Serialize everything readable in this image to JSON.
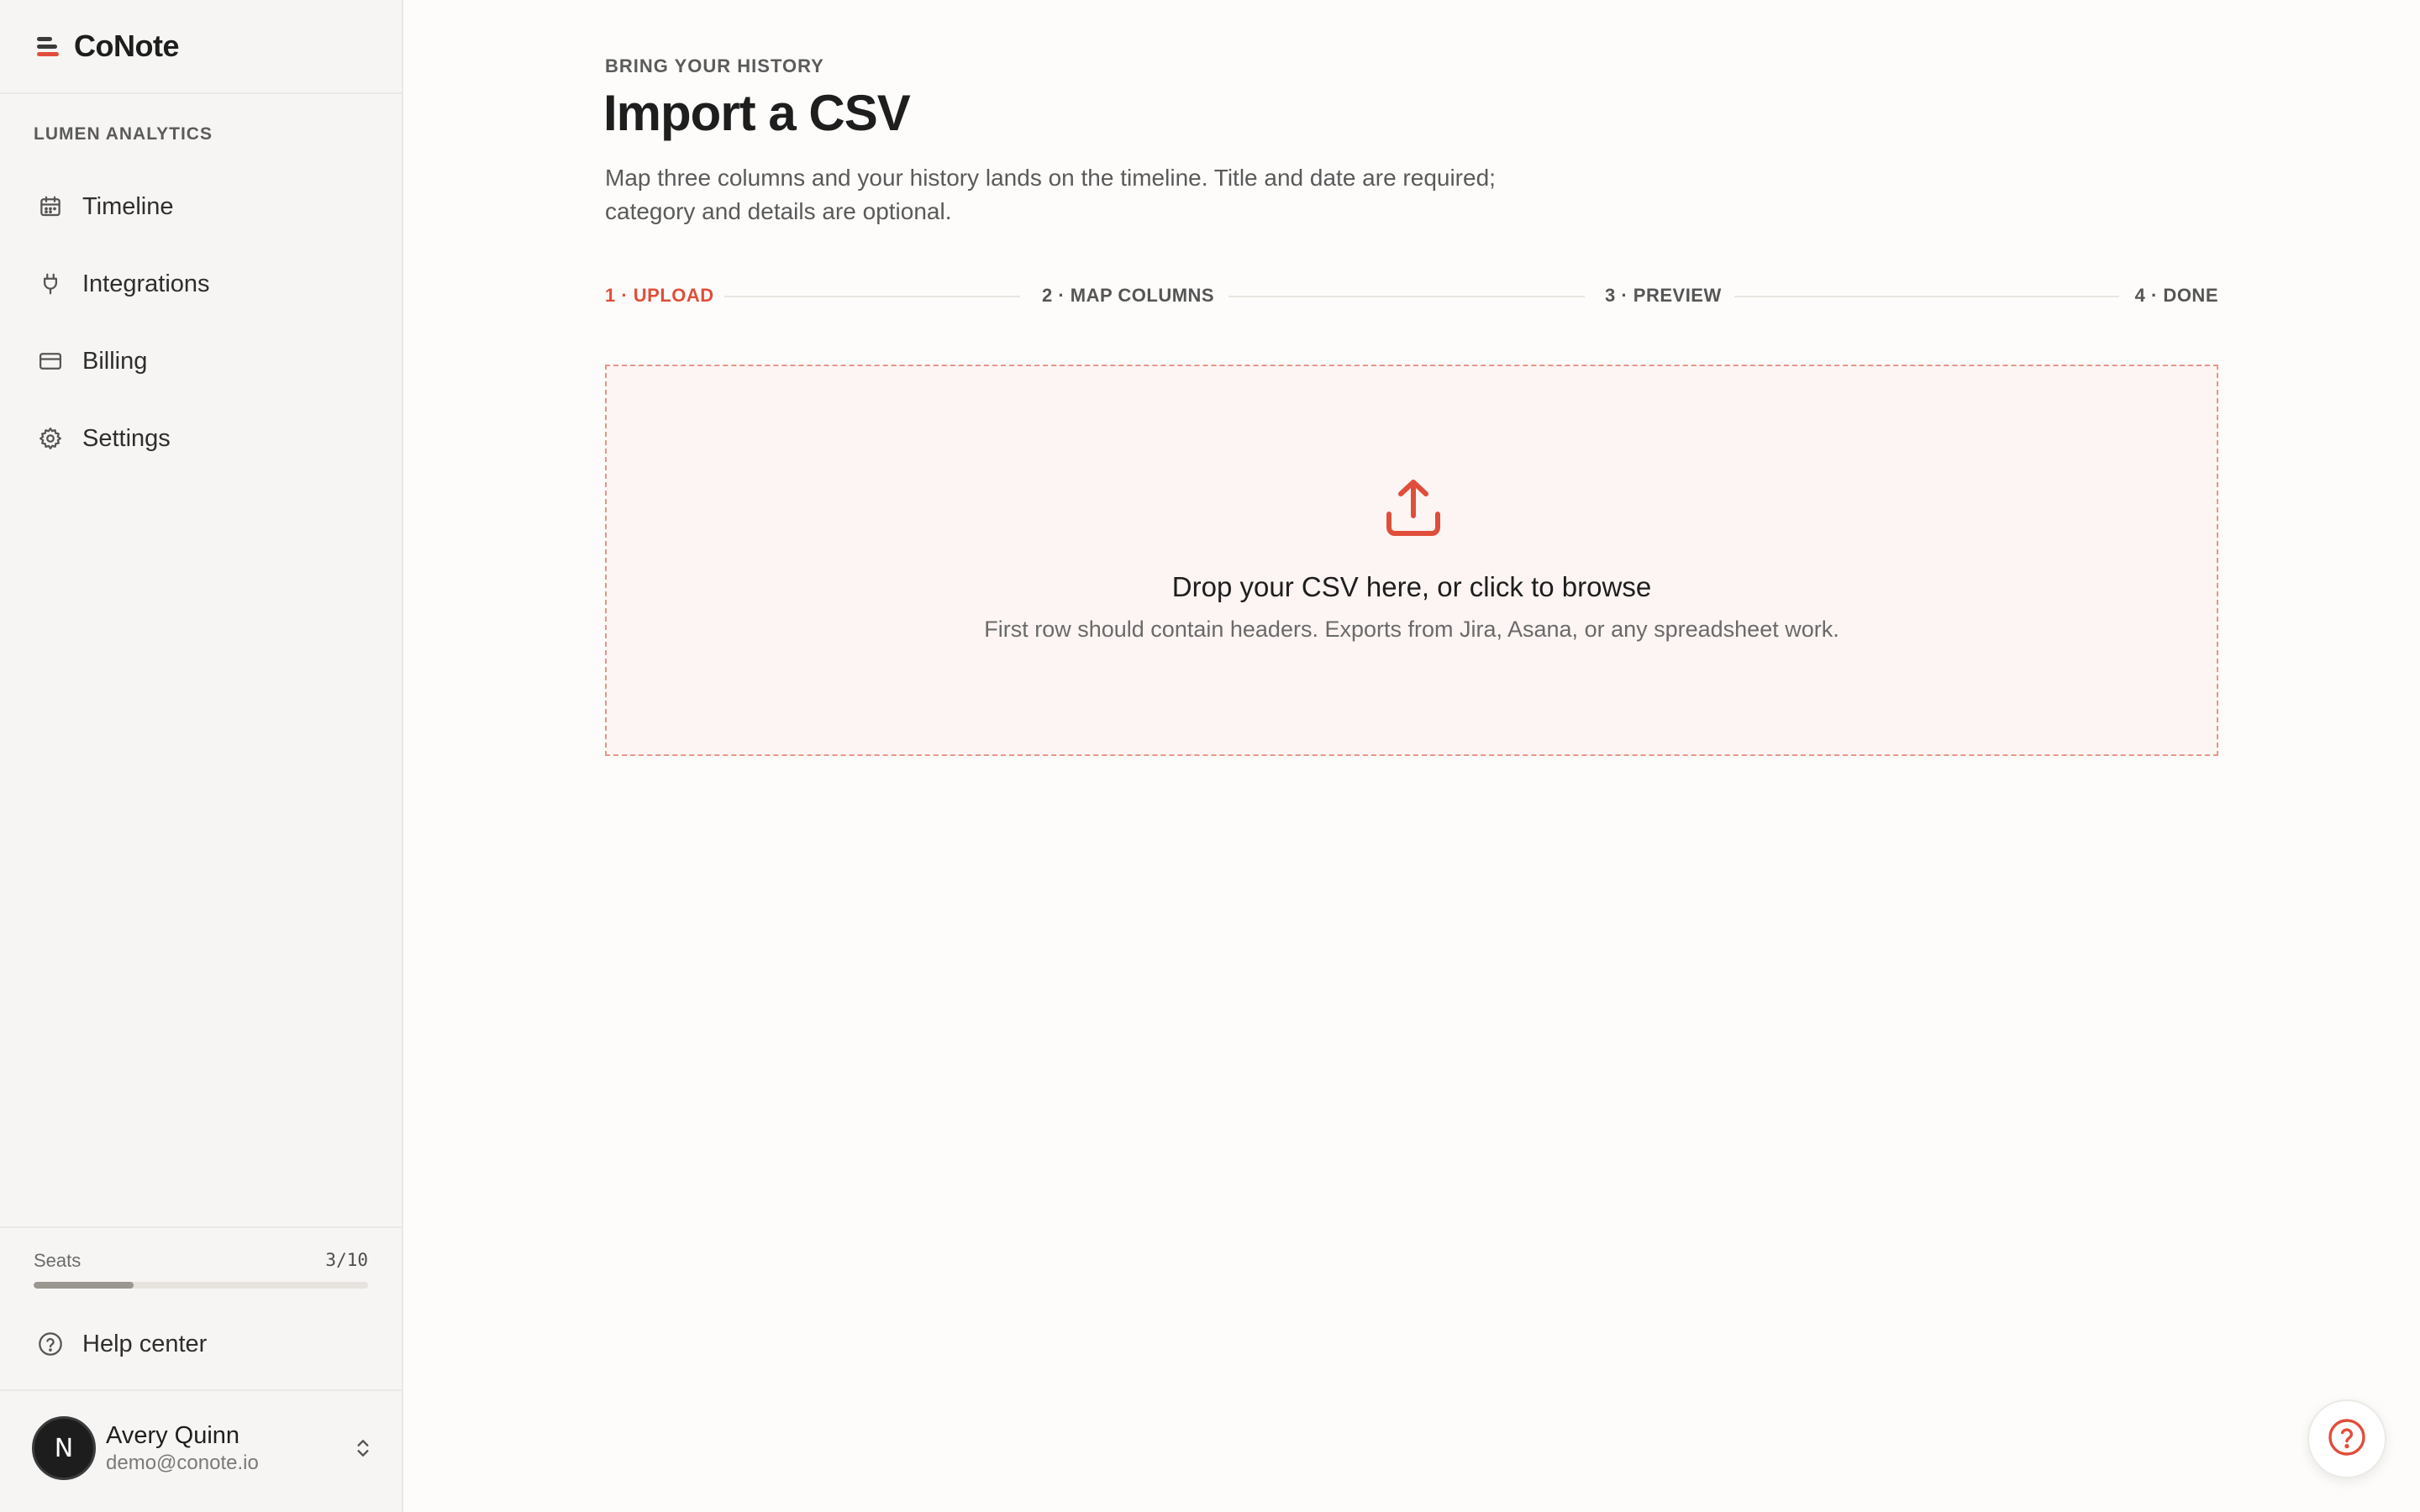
{
  "app": {
    "name": "CoNote"
  },
  "sidebar": {
    "workspace": "LUMEN ANALYTICS",
    "items": [
      {
        "label": "Timeline",
        "icon": "calendar-icon"
      },
      {
        "label": "Integrations",
        "icon": "plug-icon"
      },
      {
        "label": "Billing",
        "icon": "credit-card-icon"
      },
      {
        "label": "Settings",
        "icon": "gear-icon"
      }
    ],
    "seats": {
      "label": "Seats",
      "count": "3/10",
      "used_fraction": 0.3
    },
    "help": {
      "label": "Help center",
      "icon": "help-circle-icon"
    },
    "user": {
      "initial": "N",
      "name": "Avery Quinn",
      "email": "demo@conote.io"
    }
  },
  "main": {
    "eyebrow": "BRING YOUR HISTORY",
    "title": "Import a CSV",
    "subtitle": "Map three columns and your history lands on the timeline. Title and date are required; category and details are optional.",
    "steps": [
      {
        "label": "1 · UPLOAD",
        "active": true
      },
      {
        "label": "2 · MAP COLUMNS",
        "active": false
      },
      {
        "label": "3 · PREVIEW",
        "active": false
      },
      {
        "label": "4 · DONE",
        "active": false
      }
    ],
    "dropzone": {
      "title": "Drop your CSV here, or click to browse",
      "subtitle": "First row should contain headers. Exports from Jira, Asana, or any spreadsheet work.",
      "icon": "upload-icon"
    }
  },
  "colors": {
    "accent": "#e04e3b",
    "sidebar_bg": "#f6f5f3",
    "page_bg": "#fdfcfa"
  }
}
